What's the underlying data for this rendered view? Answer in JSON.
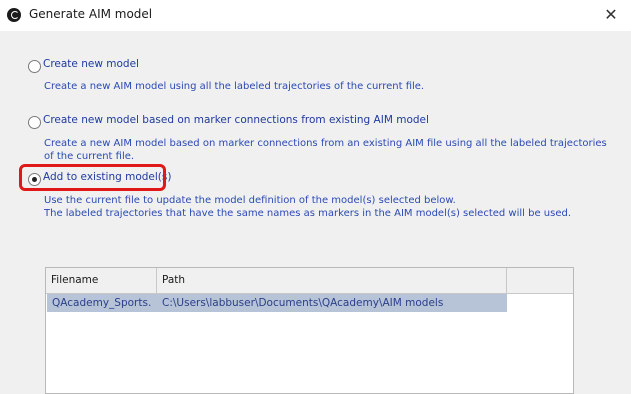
{
  "window": {
    "title": "Generate AIM model",
    "close_glyph": "✕"
  },
  "options": [
    {
      "label": "Create new model",
      "checked": false,
      "description": [
        "Create a new AIM model using all the labeled trajectories of the current file."
      ]
    },
    {
      "label": "Create new model based on marker connections from existing AIM model",
      "checked": false,
      "description": [
        "Create a new AIM model based on marker connections from an existing AIM file using all the labeled trajectories",
        "of the current file."
      ]
    },
    {
      "label": "Add to existing model(s)",
      "checked": true,
      "description": [
        "Use the current file to update the model definition of the model(s) selected below.",
        "The labeled trajectories that have the same names as markers in the AIM model(s) selected will be used."
      ]
    }
  ],
  "models_table": {
    "columns": [
      "Filename",
      "Path"
    ],
    "rows": [
      {
        "filename": "QAcademy_Sports...",
        "path": "C:\\Users\\labbuser\\Documents\\QAcademy\\AIM models",
        "selected": true
      }
    ]
  },
  "colors": {
    "highlight": "#e01818",
    "selected_row": "#b7c3d6",
    "link_text": "#2a4ab5"
  }
}
